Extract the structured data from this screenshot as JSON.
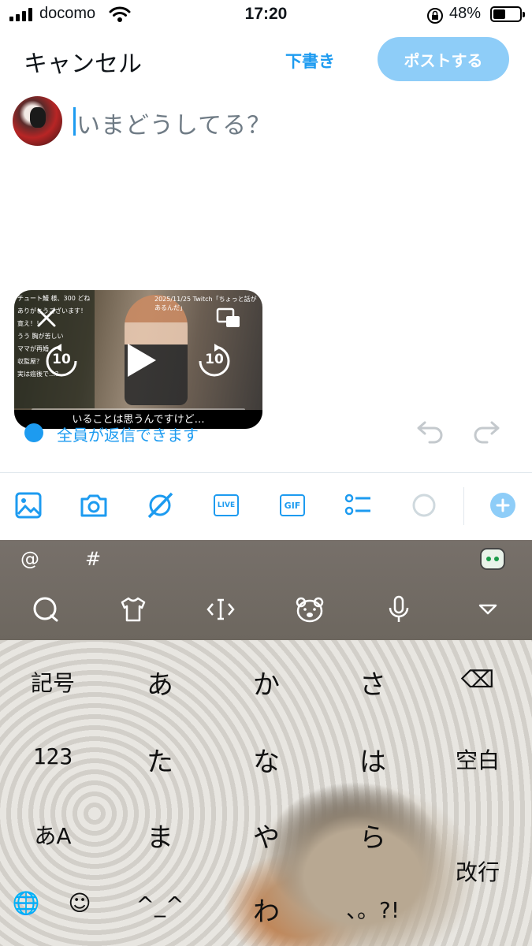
{
  "status_bar": {
    "carrier": "docomo",
    "time": "17:20",
    "battery_percent_label": "48%",
    "battery_level": 0.48
  },
  "header": {
    "cancel_label": "キャンセル",
    "draft_label": "下書き",
    "post_label": "ポストする"
  },
  "composer": {
    "placeholder": "いまどうしてる？"
  },
  "video": {
    "timestamp_caption": "2025/11/25 Twitch「ちょっと話があるんだ」",
    "subtitle": "いることは思うんですけど…",
    "chat_lines": [
      "チュート鰻 様、300 どね",
      "ありがとうございます！",
      "寛え！！",
      "うう 胸が苦しい",
      "ママが再婚",
      "収監屋？",
      "実は癌後で…？"
    ],
    "rewind_seconds": "10",
    "forward_seconds": "10"
  },
  "reply_setting": {
    "label": "全員が返信できます"
  },
  "toolbar": {
    "items": [
      "image-icon",
      "camera-icon",
      "grok-icon",
      "live-icon",
      "gif-icon",
      "poll-icon",
      "progress-circle-icon",
      "add-thread-icon"
    ],
    "live_label": "LIVE",
    "gif_label": "GIF"
  },
  "keyboard": {
    "symbols": [
      "@",
      "#"
    ],
    "rows": [
      [
        "記号",
        "あ",
        "か",
        "さ",
        "⌫"
      ],
      [
        "123",
        "た",
        "な",
        "は",
        "空白"
      ],
      [
        "あA",
        "ま",
        "や",
        "ら",
        "改行"
      ],
      [
        "🌐",
        "☺",
        "^_^",
        "わ",
        "、。?!"
      ]
    ],
    "accent_color": "#1d9bf0",
    "post_disabled_color": "#8ecdf8"
  }
}
